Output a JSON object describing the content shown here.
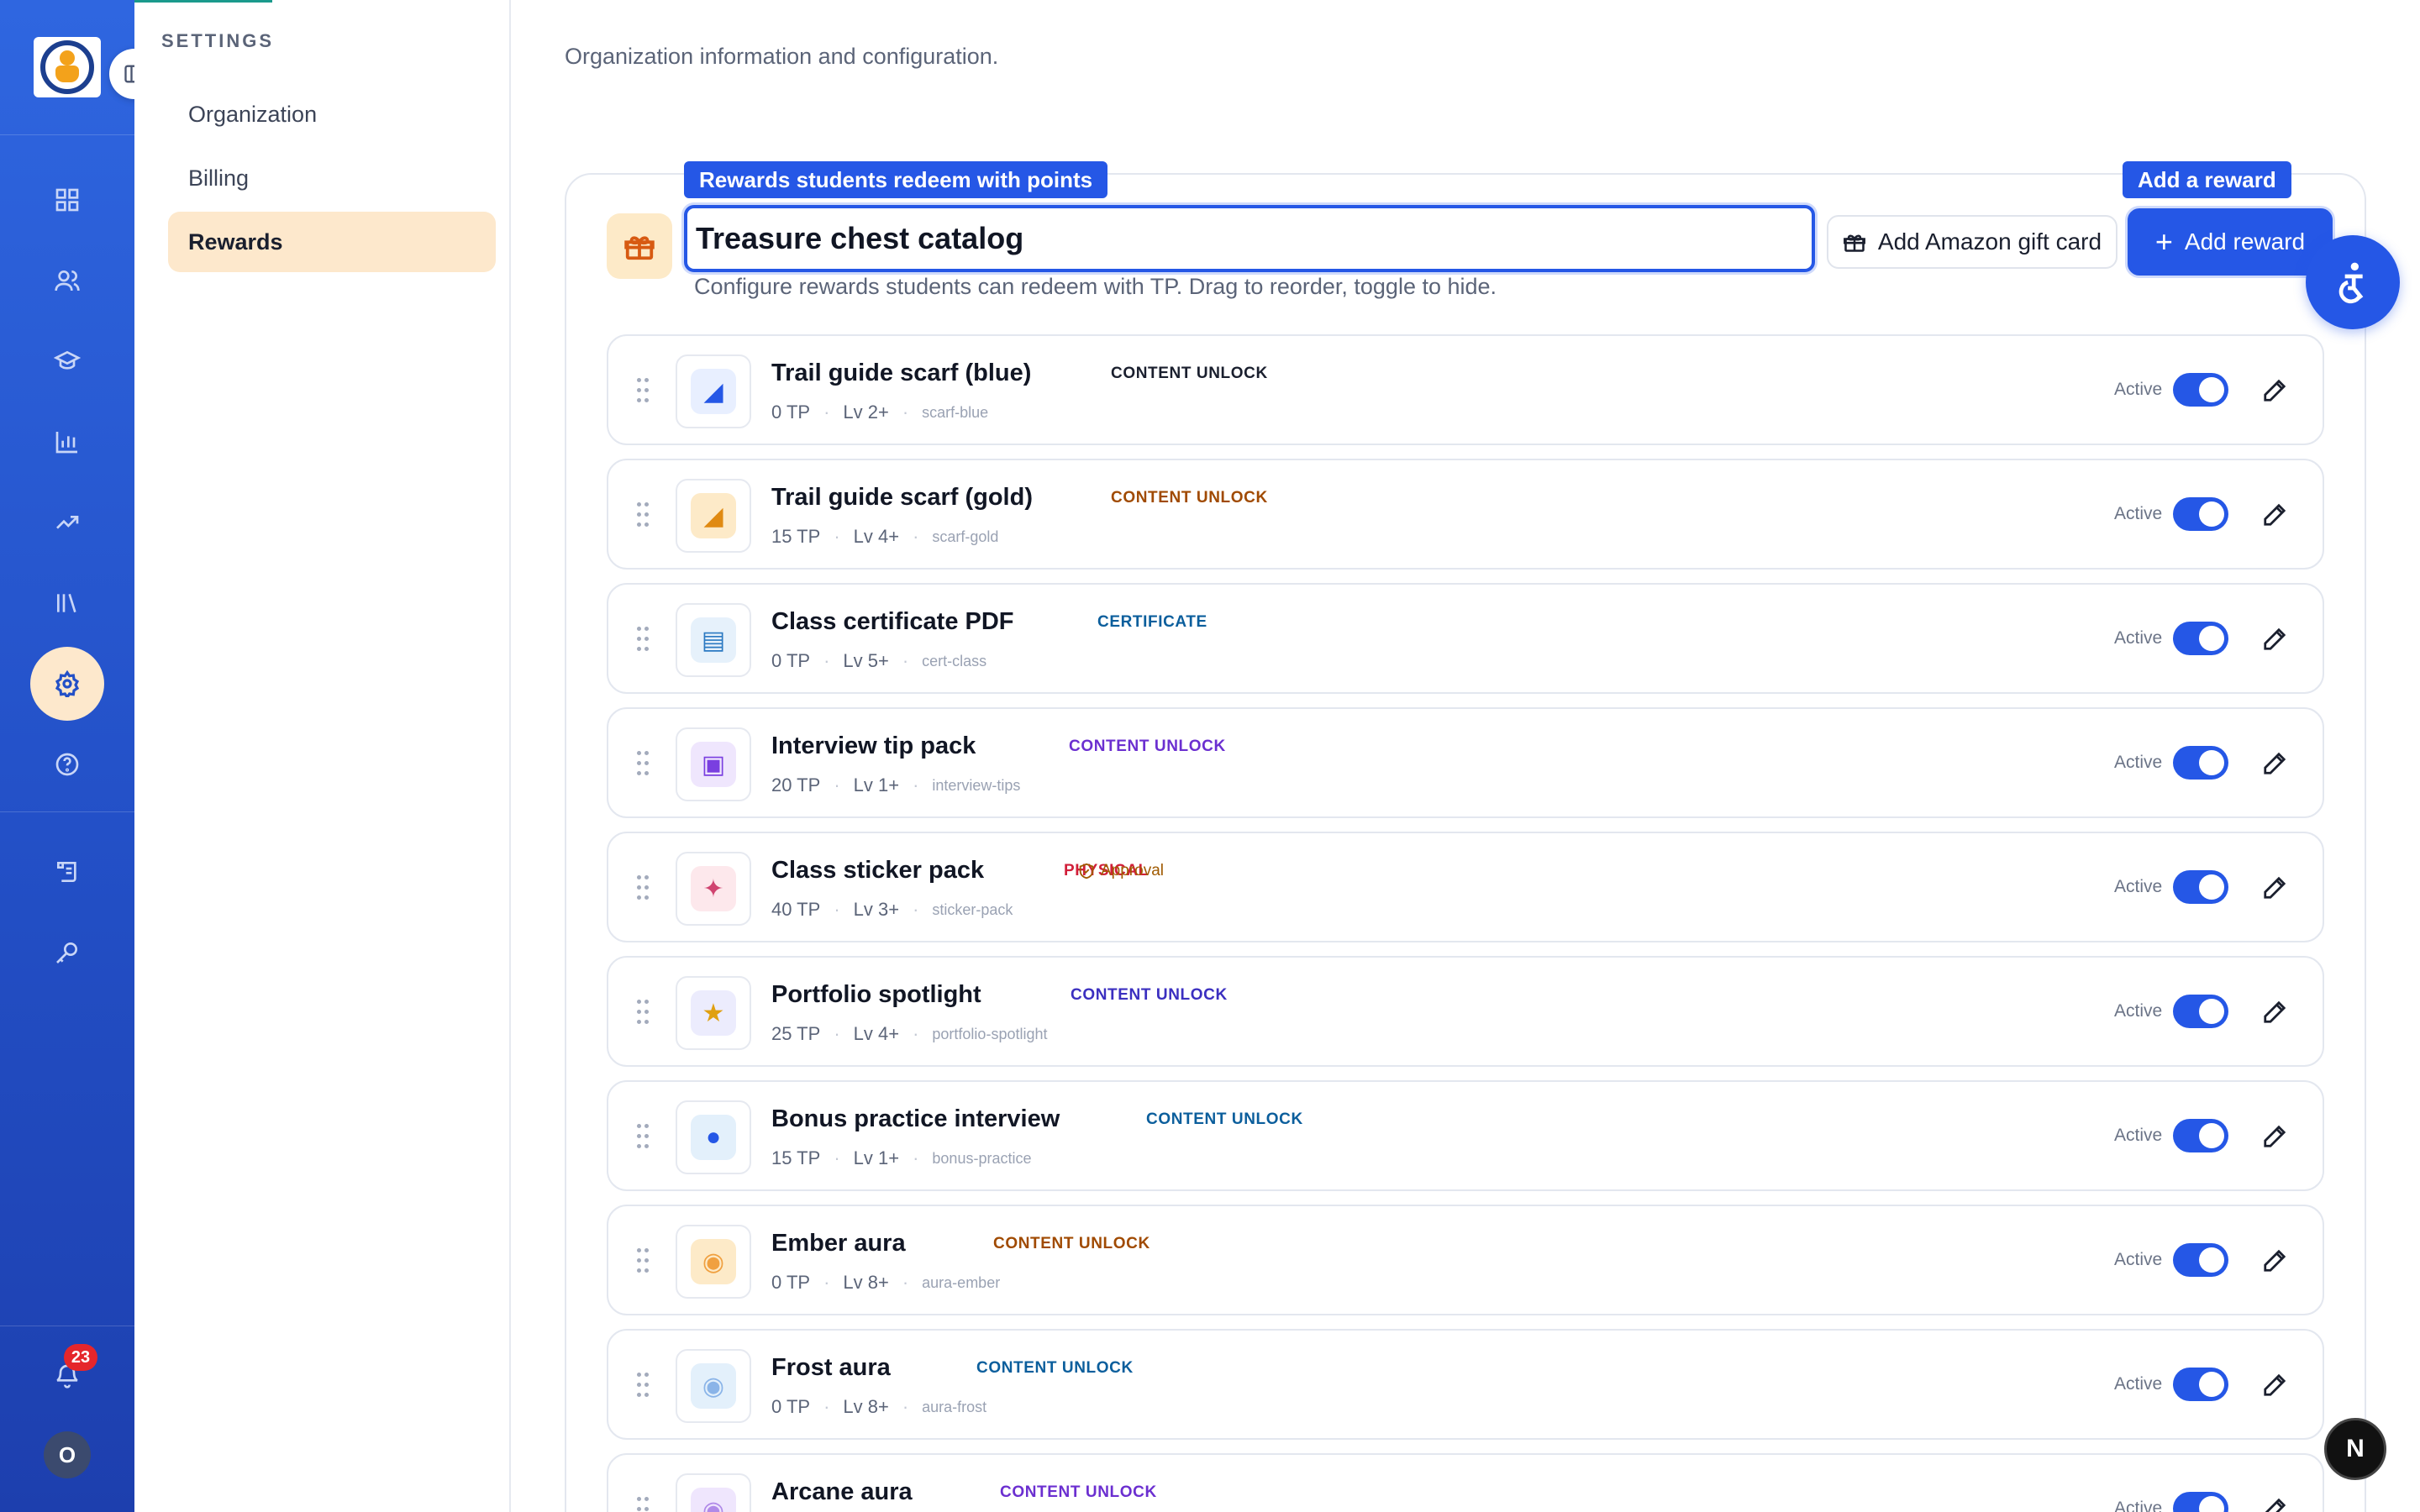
{
  "rail": {
    "notification_count": "23",
    "avatar_initial": "O",
    "active_item": "settings"
  },
  "settings": {
    "heading": "SETTINGS",
    "items": [
      {
        "label": "Organization",
        "active": false
      },
      {
        "label": "Billing",
        "active": false
      },
      {
        "label": "Rewards",
        "active": true
      }
    ]
  },
  "main": {
    "subtitle": "Organization information and configuration.",
    "tooltip_title": "Rewards students redeem with points",
    "tooltip_add": "Add a reward",
    "catalog_title": "Treasure chest catalog",
    "helper": "Configure rewards students can redeem with TP. Drag to reorder, toggle to hide.",
    "amazon_button": "Add Amazon gift card",
    "add_button": "Add reward"
  },
  "rewards": [
    {
      "name": "Trail guide scarf (blue)",
      "tag": "CONTENT UNLOCK",
      "tag_color": "#1a1f2e",
      "points": "0 TP",
      "level": "Lv 2+",
      "slug": "scarf-blue",
      "status": "Active",
      "thumb_bg": "#e8efff",
      "thumb_color": "#2557e6",
      "icon": "scarf-icon"
    },
    {
      "name": "Trail guide scarf (gold)",
      "tag": "CONTENT UNLOCK",
      "tag_color": "#a04a00",
      "points": "15 TP",
      "level": "Lv 4+",
      "slug": "scarf-gold",
      "status": "Active",
      "thumb_bg": "#fdeac8",
      "thumb_color": "#e08a12",
      "icon": "scarf-icon"
    },
    {
      "name": "Class certificate PDF",
      "tag": "CERTIFICATE",
      "tag_color": "#0b5e9c",
      "points": "0 TP",
      "level": "Lv 5+",
      "slug": "cert-class",
      "status": "Active",
      "thumb_bg": "#e6f1fb",
      "thumb_color": "#2b79c2",
      "icon": "certificate-icon"
    },
    {
      "name": "Interview tip pack",
      "tag": "CONTENT UNLOCK",
      "tag_color": "#6b2fd0",
      "points": "20 TP",
      "level": "Lv 1+",
      "slug": "interview-tips",
      "status": "Active",
      "thumb_bg": "#efe6fd",
      "thumb_color": "#7a3fe0",
      "icon": "pack-icon"
    },
    {
      "name": "Class sticker pack",
      "tag": "PHYSICAL",
      "tag_color": "#d11f3a",
      "approval": "Approval",
      "points": "40 TP",
      "level": "Lv 3+",
      "slug": "sticker-pack",
      "status": "Active",
      "thumb_bg": "#fde8ec",
      "thumb_color": "#d04470",
      "icon": "sticker-icon"
    },
    {
      "name": "Portfolio spotlight",
      "tag": "CONTENT UNLOCK",
      "tag_color": "#3b2fc0",
      "points": "25 TP",
      "level": "Lv 4+",
      "slug": "portfolio-spotlight",
      "status": "Active",
      "thumb_bg": "#ececfd",
      "thumb_color": "#e0a010",
      "icon": "star-icon"
    },
    {
      "name": "Bonus practice interview",
      "tag": "CONTENT UNLOCK",
      "tag_color": "#0b5e9c",
      "points": "15 TP",
      "level": "Lv 1+",
      "slug": "bonus-practice",
      "status": "Active",
      "thumb_bg": "#e3f0fb",
      "thumb_color": "#2557e6",
      "icon": "microphone-icon"
    },
    {
      "name": "Ember aura",
      "tag": "CONTENT UNLOCK",
      "tag_color": "#a04a00",
      "points": "0 TP",
      "level": "Lv 8+",
      "slug": "aura-ember",
      "status": "Active",
      "thumb_bg": "#fdeac8",
      "thumb_color": "#f0a040",
      "icon": "aura-icon"
    },
    {
      "name": "Frost aura",
      "tag": "CONTENT UNLOCK",
      "tag_color": "#0b5e9c",
      "points": "0 TP",
      "level": "Lv 8+",
      "slug": "aura-frost",
      "status": "Active",
      "thumb_bg": "#e3f0fb",
      "thumb_color": "#8ab4e8",
      "icon": "aura-icon"
    },
    {
      "name": "Arcane aura",
      "tag": "CONTENT UNLOCK",
      "tag_color": "#6b2fd0",
      "points": "",
      "level": "",
      "slug": "",
      "status": "Active",
      "thumb_bg": "#efe6fd",
      "thumb_color": "#b08ae8",
      "icon": "aura-icon"
    }
  ]
}
